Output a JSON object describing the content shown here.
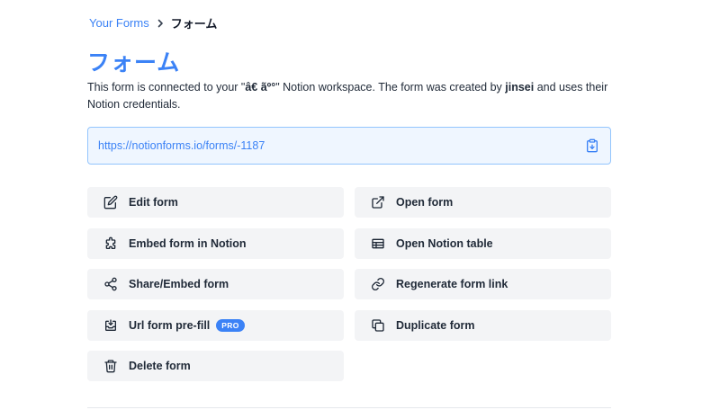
{
  "breadcrumb": {
    "parent": "Your Forms",
    "current": "フォーム"
  },
  "page": {
    "title": "フォーム",
    "description_prefix": "This form is connected to your \"",
    "workspace_name": "â€   ãº°",
    "description_middle": "\" Notion workspace. The form was created by ",
    "creator": "jinsei",
    "description_suffix": " and uses their Notion credentials."
  },
  "form_url": "https://notionforms.io/forms/-1187",
  "actions": {
    "edit_form": "Edit form",
    "open_form": "Open form",
    "embed_in_notion": "Embed form in Notion",
    "open_notion_table": "Open Notion table",
    "share_embed": "Share/Embed form",
    "regenerate_link": "Regenerate form link",
    "url_prefill": "Url form pre-fill",
    "pro_badge": "PRO",
    "duplicate_form": "Duplicate form",
    "delete_form": "Delete form"
  },
  "colors": {
    "accent": "#3b82f6",
    "url_bg": "#eff6ff",
    "url_border": "#93c5fd",
    "button_bg": "#f3f4f6"
  },
  "icons": {
    "breadcrumb_separator": "chevron-right-icon",
    "copy": "clipboard-copy-icon",
    "edit_form": "pencil-square-icon",
    "open_form": "external-link-icon",
    "embed_in_notion": "puzzle-icon",
    "open_notion_table": "table-icon",
    "share_embed": "share-icon",
    "regenerate_link": "link-icon",
    "url_prefill": "inbox-download-icon",
    "duplicate_form": "duplicate-icon",
    "delete_form": "trash-icon"
  }
}
